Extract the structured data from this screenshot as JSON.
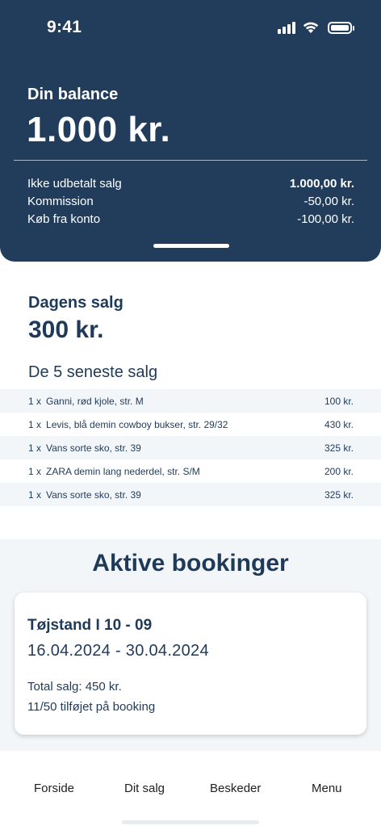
{
  "status_bar": {
    "time": "9:41",
    "icons": [
      "signal-icon",
      "wifi-icon",
      "battery-icon"
    ]
  },
  "balance": {
    "label": "Din balance",
    "amount": "1.000 kr.",
    "breakdown": [
      {
        "label": "Ikke udbetalt salg",
        "value": "1.000,00 kr."
      },
      {
        "label": "Kommission",
        "value": "-50,00 kr."
      },
      {
        "label": "Køb fra konto",
        "value": "-100,00 kr."
      }
    ]
  },
  "daily": {
    "label": "Dagens salg",
    "amount": "300 kr.",
    "recent_title": "De 5 seneste salg",
    "sales": [
      {
        "qty": "1 x",
        "item": "Ganni, rød kjole, str. M",
        "price": "100 kr."
      },
      {
        "qty": "1 x",
        "item": "Levis, blå demin cowboy bukser, str. 29/32",
        "price": "430 kr."
      },
      {
        "qty": "1 x",
        "item": "Vans sorte sko, str. 39",
        "price": "325 kr."
      },
      {
        "qty": "1 x",
        "item": "ZARA demin lang nederdel, str. S/M",
        "price": "200 kr."
      },
      {
        "qty": "1 x",
        "item": "Vans sorte sko, str. 39",
        "price": "325 kr."
      }
    ]
  },
  "bookings": {
    "title": "Aktive bookinger",
    "card": {
      "name": "Tøjstand I 10 - 09",
      "dates": "16.04.2024 - 30.04.2024",
      "total": "Total salg: 450 kr.",
      "added": "11/50 tilføjet på booking"
    }
  },
  "nav": {
    "items": [
      "Forside",
      "Dit salg",
      "Beskeder",
      "Menu"
    ]
  },
  "colors": {
    "header_bg": "#223d5b",
    "text_primary": "#1f3a59",
    "section_bg": "#f3f6f9"
  }
}
